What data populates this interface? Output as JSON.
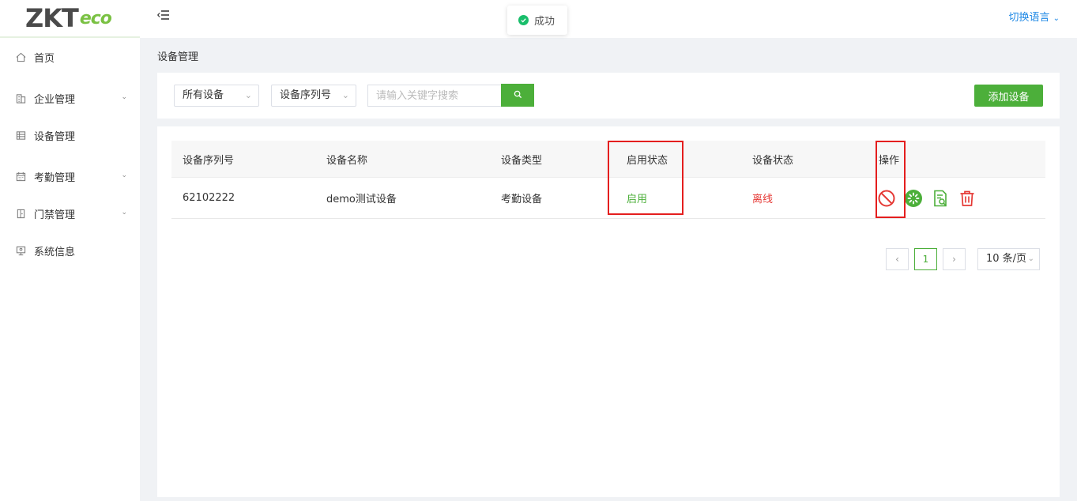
{
  "brand": {
    "logo_main": "ZKT",
    "logo_eco": "eco"
  },
  "sidebar": {
    "items": [
      {
        "label": "首页",
        "icon": "home-icon",
        "expandable": false
      },
      {
        "label": "企业管理",
        "icon": "building-icon",
        "expandable": true
      },
      {
        "label": "设备管理",
        "icon": "device-list-icon",
        "expandable": false
      },
      {
        "label": "考勤管理",
        "icon": "calendar-icon",
        "expandable": true
      },
      {
        "label": "门禁管理",
        "icon": "door-icon",
        "expandable": true
      },
      {
        "label": "系统信息",
        "icon": "monitor-icon",
        "expandable": false
      }
    ]
  },
  "header": {
    "language_switch": "切换语言",
    "toast": "成功"
  },
  "breadcrumb": "设备管理",
  "filters": {
    "device_filter": "所有设备",
    "field_filter": "设备序列号",
    "search_placeholder": "请输入关键字搜索",
    "add_button": "添加设备"
  },
  "table": {
    "columns": [
      "设备序列号",
      "设备名称",
      "设备类型",
      "启用状态",
      "设备状态",
      "操作"
    ],
    "rows": [
      {
        "serial": "62102222",
        "name": "demo测试设备",
        "type": "考勤设备",
        "enabled": "启用",
        "status": "离线"
      }
    ]
  },
  "pagination": {
    "current_page": "1",
    "page_size": "10 条/页"
  },
  "colors": {
    "accent": "#4caf3a",
    "danger": "#e53935",
    "highlight": "#e41e1e"
  }
}
